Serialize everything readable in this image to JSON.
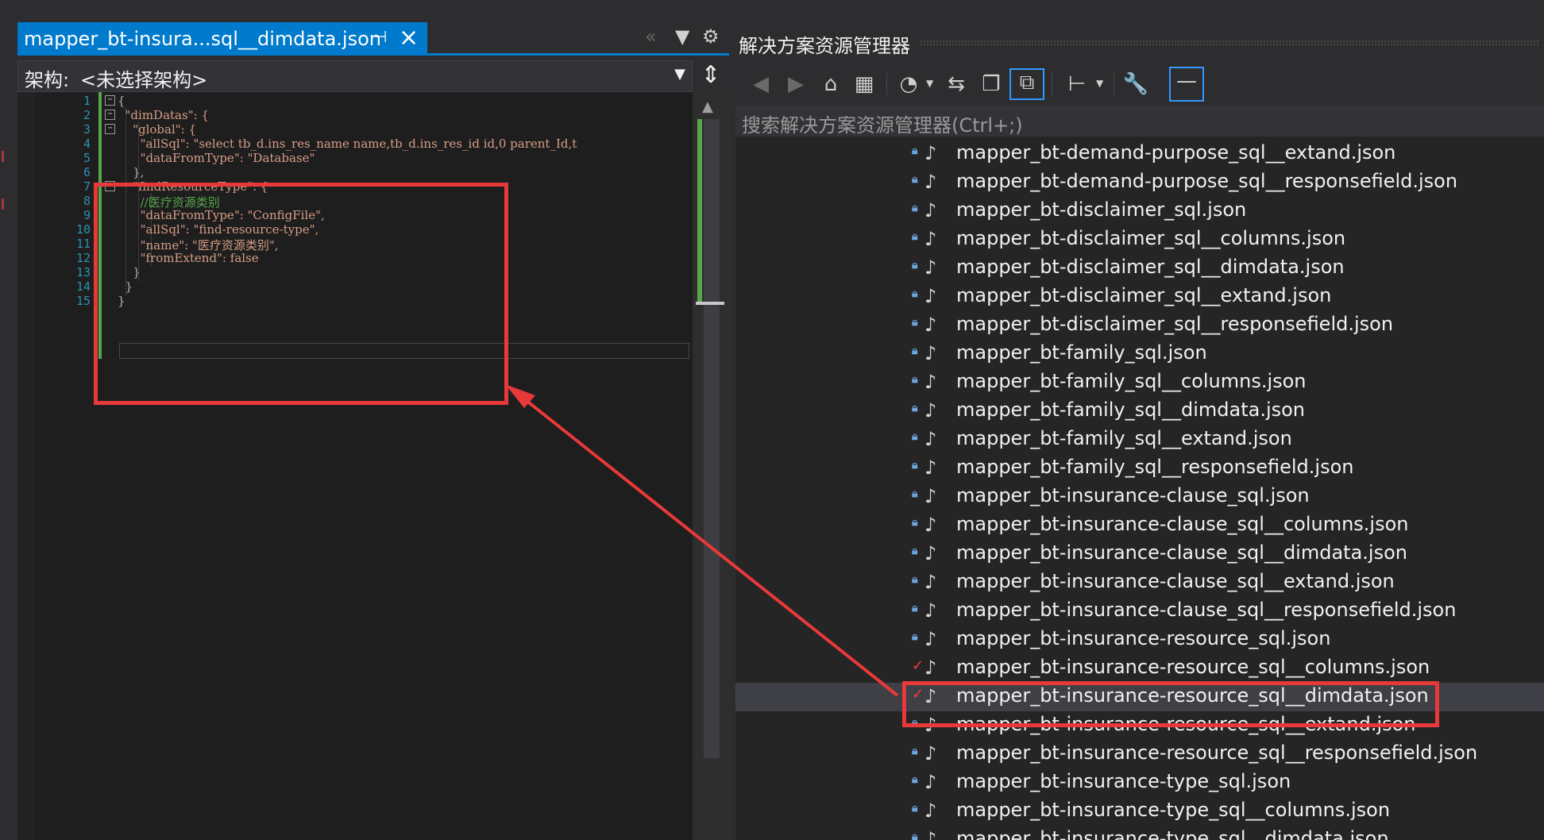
{
  "editor": {
    "tab_title": "mapper_bt-insura...sql__dimdata.json",
    "pin_icon": "pin-icon",
    "close_icon": "close-icon",
    "nav_label": "架构:",
    "nav_value": "<未选择架构>",
    "line_numbers": [
      "1",
      "2",
      "3",
      "4",
      "5",
      "6",
      "7",
      "8",
      "9",
      "10",
      "11",
      "12",
      "13",
      "14",
      "15"
    ],
    "code_lines": [
      "{",
      "  \"dimDatas\": {",
      "    \"global\": {",
      "      \"allSql\": \"select tb_d.ins_res_name name,tb_d.ins_res_id id,0 parent_Id,t",
      "      \"dataFromType\": \"Database\"",
      "    },",
      "    \"findResourceType\": {",
      "      //医疗资源类别",
      "      \"dataFromType\": \"ConfigFile\",",
      "      \"allSql\": \"find-resource-type\",",
      "      \"name\": \"医疗资源类别\",",
      "      \"fromExtend\": false",
      "    }",
      "  }",
      "}"
    ]
  },
  "solution_explorer": {
    "title": "解决方案资源管理器",
    "search_placeholder": "搜索解决方案资源管理器(Ctrl+;)",
    "toolbar_icons": [
      "back-icon",
      "forward-icon",
      "home-icon",
      "vs-project-icon",
      "history-icon",
      "sync-icon",
      "collapse-icon",
      "show-all-files-icon",
      "tree-view-icon",
      "properties-icon",
      "preview-icon"
    ],
    "files": [
      {
        "name": "mapper_bt-demand-purpose_sql__extand.json",
        "status": "lock"
      },
      {
        "name": "mapper_bt-demand-purpose_sql__responsefield.json",
        "status": "lock"
      },
      {
        "name": "mapper_bt-disclaimer_sql.json",
        "status": "lock"
      },
      {
        "name": "mapper_bt-disclaimer_sql__columns.json",
        "status": "lock"
      },
      {
        "name": "mapper_bt-disclaimer_sql__dimdata.json",
        "status": "lock"
      },
      {
        "name": "mapper_bt-disclaimer_sql__extand.json",
        "status": "lock"
      },
      {
        "name": "mapper_bt-disclaimer_sql__responsefield.json",
        "status": "lock"
      },
      {
        "name": "mapper_bt-family_sql.json",
        "status": "lock"
      },
      {
        "name": "mapper_bt-family_sql__columns.json",
        "status": "lock"
      },
      {
        "name": "mapper_bt-family_sql__dimdata.json",
        "status": "lock"
      },
      {
        "name": "mapper_bt-family_sql__extand.json",
        "status": "lock"
      },
      {
        "name": "mapper_bt-family_sql__responsefield.json",
        "status": "lock"
      },
      {
        "name": "mapper_bt-insurance-clause_sql.json",
        "status": "lock"
      },
      {
        "name": "mapper_bt-insurance-clause_sql__columns.json",
        "status": "lock"
      },
      {
        "name": "mapper_bt-insurance-clause_sql__dimdata.json",
        "status": "lock"
      },
      {
        "name": "mapper_bt-insurance-clause_sql__extand.json",
        "status": "lock"
      },
      {
        "name": "mapper_bt-insurance-clause_sql__responsefield.json",
        "status": "lock"
      },
      {
        "name": "mapper_bt-insurance-resource_sql.json",
        "status": "lock"
      },
      {
        "name": "mapper_bt-insurance-resource_sql__columns.json",
        "status": "checked"
      },
      {
        "name": "mapper_bt-insurance-resource_sql__dimdata.json",
        "status": "checked",
        "selected": true
      },
      {
        "name": "mapper_bt-insurance-resource_sql__extand.json",
        "status": "lock"
      },
      {
        "name": "mapper_bt-insurance-resource_sql__responsefield.json",
        "status": "lock"
      },
      {
        "name": "mapper_bt-insurance-type_sql.json",
        "status": "lock"
      },
      {
        "name": "mapper_bt-insurance-type_sql__columns.json",
        "status": "lock"
      },
      {
        "name": "mapper_bt-insurance-type_sql__dimdata.json",
        "status": "lock"
      }
    ]
  },
  "colors": {
    "accent": "#007acc",
    "annotation_red": "#e8393a",
    "editor_bg": "#1e1e1e",
    "json_string": "#d69d85",
    "comment": "#57a64a",
    "keyword": "#569cd6"
  }
}
